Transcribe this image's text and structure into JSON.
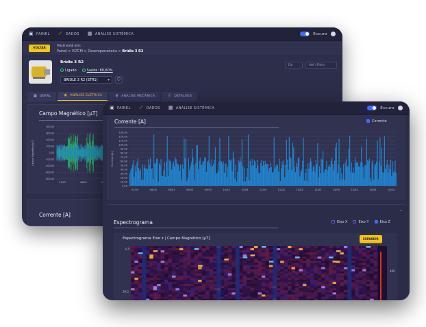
{
  "back": {
    "nav": {
      "painel": "PAINEL",
      "dados": "DADOS",
      "analise": "ANÁLISE SISTÊMICA"
    },
    "theme_label": "Escuro",
    "voltar": "VOLTAR",
    "crumb_intro": "Você está em:",
    "crumb_path": "Painel > PLTCM > Desempenadeira >",
    "crumb_current": "Bridle 3 R2",
    "equipment_name": "Bridle 3 R2",
    "status_on": "Ligado",
    "status_health": "Saúde: 80,60%",
    "equipment_select": "BRIDLE 3 R2 (STR1)",
    "date_from": "De",
    "date_to": "Até / Filtro",
    "tabs": [
      "GERAL",
      "ANÁLISE ELÉTRICA",
      "ANÁLISE MECÂNICA",
      "DETALHES"
    ],
    "panel1_title": "Campo Magnético [µT]",
    "panel1_ylabel": "Campo Magnético [µT]",
    "panel1_yticks": [
      "800,00",
      "600,00",
      "400,00",
      "200,00",
      "0,00",
      "-200,00",
      "-400,00",
      "-600,00",
      "-800,00"
    ],
    "panel1_xticks": [
      "07/03",
      "08/03",
      "09/03"
    ],
    "panel2_title": "Corrente [A]"
  },
  "front": {
    "nav": {
      "painel": "PAINEL",
      "dados": "DADOS",
      "analise": "ANÁLISE SISTÊMICA"
    },
    "theme_label": "Escuro",
    "current_title": "Corrente [A]",
    "current_legend": "Corrente",
    "current_ylabel": "Corrente [A]",
    "spectro_title": "Espectrograma",
    "spectro_legend": [
      "Eixo X",
      "Eixo Y",
      "Eixo Z"
    ],
    "spectro_sub": "Espectrograma Eixo z | Campo Magnético [µT]",
    "expandir": "EXPANDIR",
    "spectro_yticks": [
      "0,5",
      "39,5"
    ],
    "spectro_right_tick": "400"
  },
  "chart_data": {
    "type": "bar",
    "title": "Corrente [A]",
    "ylabel": "Corrente [A]",
    "ylim": [
      0,
      130
    ],
    "yticks": [
      "130,00",
      "120,00",
      "110,00",
      "100,00",
      "90,00",
      "80,00",
      "70,00",
      "60,00",
      "50,00",
      "40,00",
      "30,00",
      "20,00",
      "10,00",
      "0,00"
    ],
    "xticks": [
      "07/03",
      "08/03",
      "08/03",
      "09/03",
      "09/03",
      "10/03",
      "10/03",
      "11/03",
      "11/03",
      "12/03",
      "12/03",
      "13/03",
      "13/03",
      "14/03",
      "14/03"
    ],
    "series": [
      {
        "name": "Corrente",
        "color": "#1f8fe0"
      }
    ]
  },
  "colors": {
    "accent": "#f2c318",
    "bg": "#2c2e4a",
    "series_blue": "#1f8fe0",
    "green": "#31d07a"
  }
}
